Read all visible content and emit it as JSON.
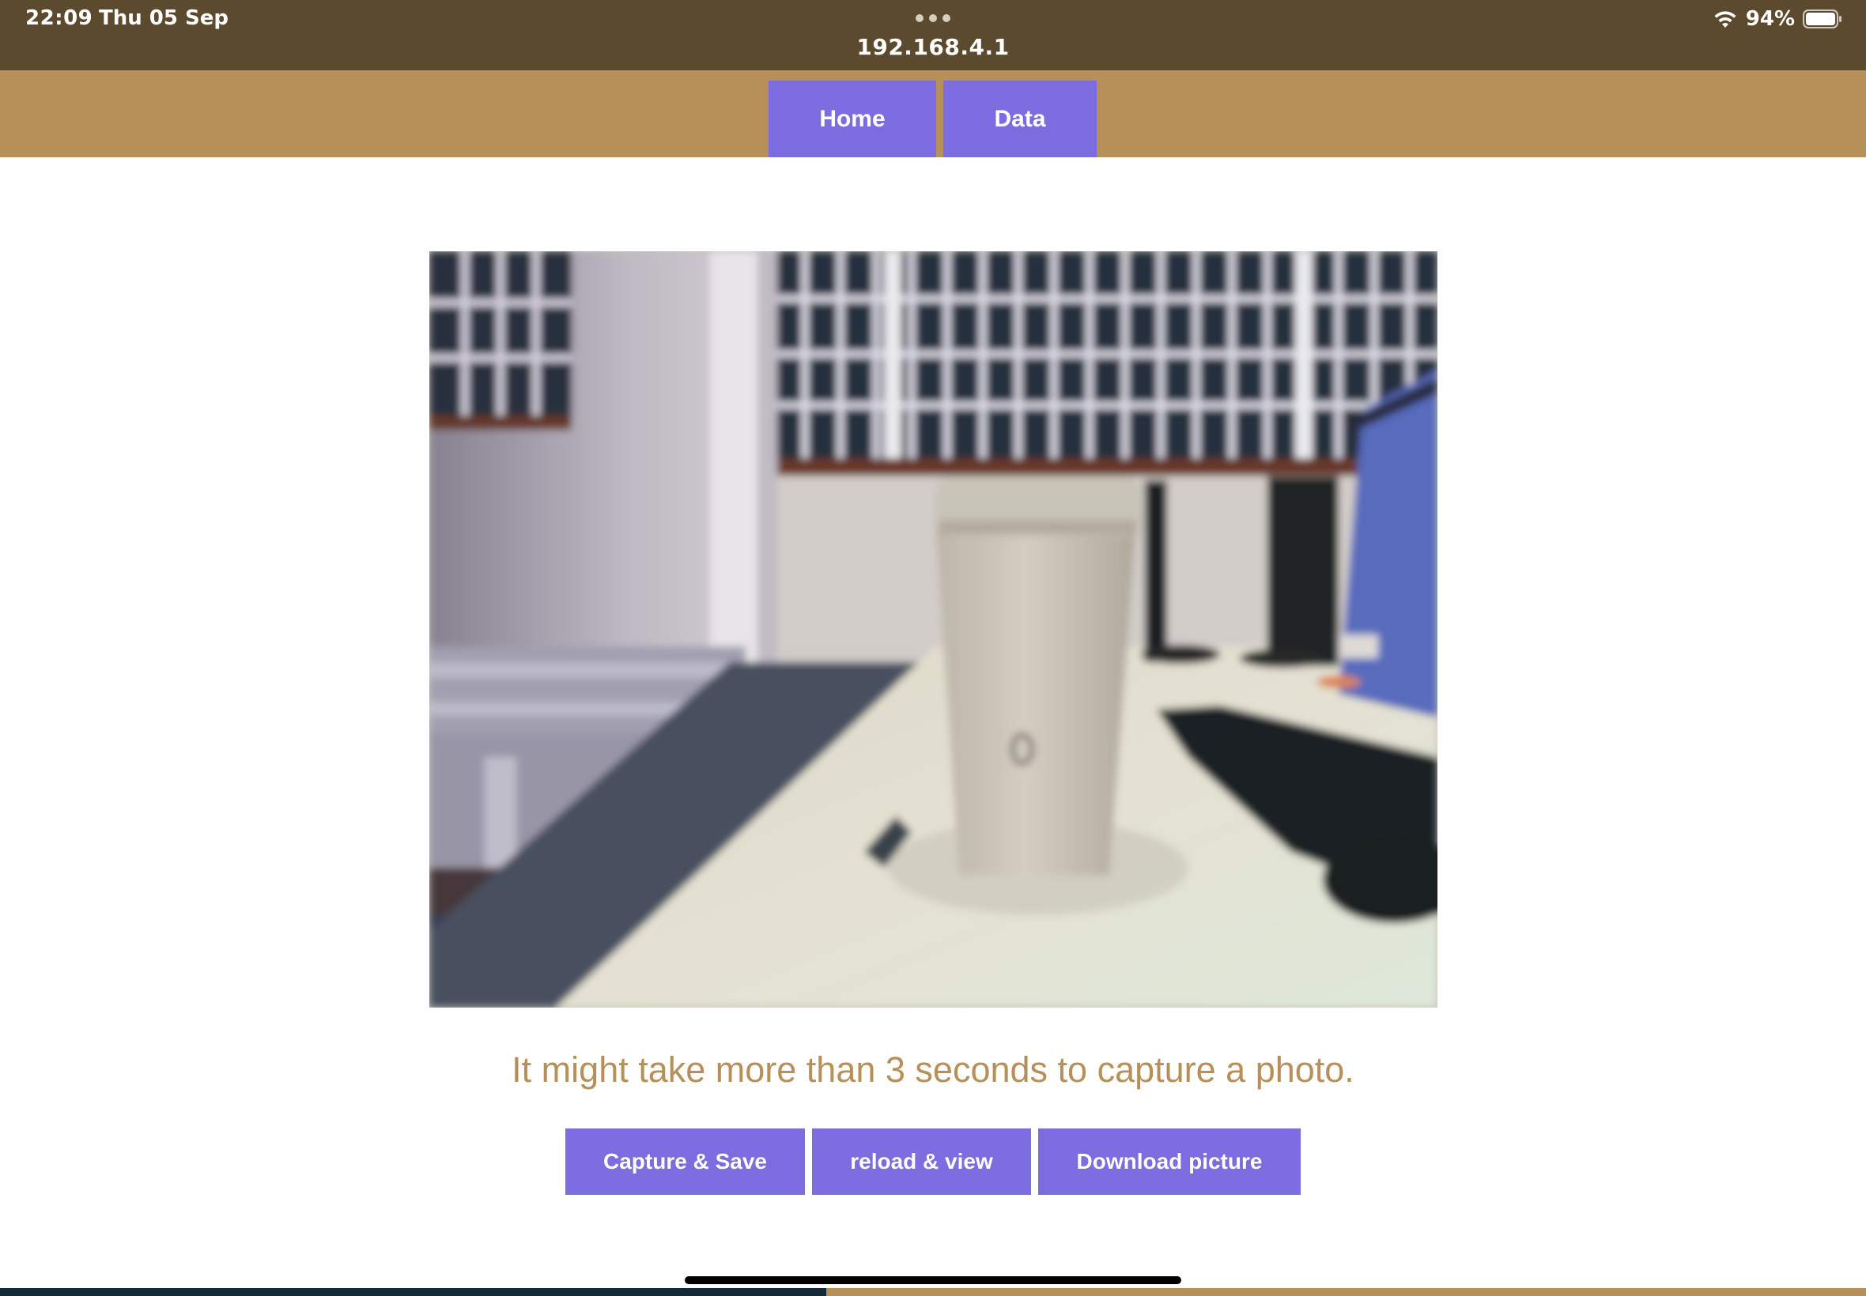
{
  "status_bar": {
    "time": "22:09",
    "date": "Thu 05 Sep",
    "address": "192.168.4.1",
    "battery_percent": "94%"
  },
  "nav": {
    "home_label": "Home",
    "data_label": "Data"
  },
  "main": {
    "notice": "It might take more than 3 seconds to capture a photo.",
    "buttons": {
      "capture_save": "Capture & Save",
      "reload_view": "reload & view",
      "download": "Download picture"
    }
  },
  "colors": {
    "status_bar_bg": "#5c4a2f",
    "nav_bg": "#b78f58",
    "button_bg": "#7b6ce0",
    "notice_text": "#b78f58"
  },
  "icons": {
    "multitask": "ellipsis-icon",
    "wifi": "wifi-icon",
    "battery": "battery-icon"
  }
}
